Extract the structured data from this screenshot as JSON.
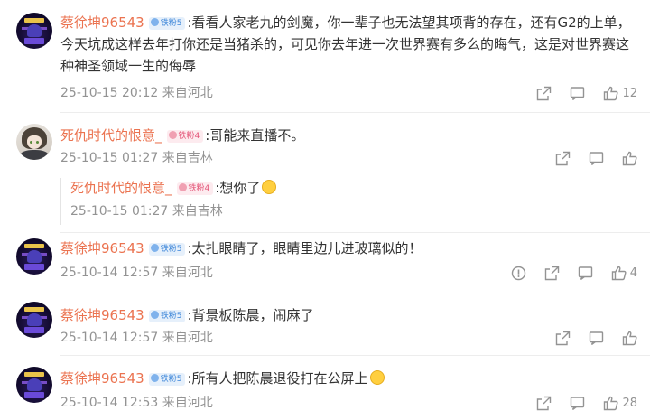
{
  "comments": [
    {
      "username": "蔡徐坤96543",
      "badge": "铁粉5",
      "text_lines": [
        "看看人家老九的剑魔，你一辈子也无法望其项背的存在，还有G2的上单，",
        "今天坑成这样去年打你还是当猪杀的，可见你去年进一次世界赛有多么的晦气，这是对世界赛这",
        "种神圣领域一生的侮辱"
      ],
      "timestamp": "25-10-15 20:12",
      "location": "来自河北",
      "likes": "12"
    },
    {
      "username": "死仇时代的恨意_",
      "badge": "铁粉4",
      "text": "哥能来直播不。",
      "timestamp": "25-10-15 01:27",
      "location": "来自吉林",
      "reply": {
        "username": "死仇时代的恨意_",
        "badge": "铁粉4",
        "text": "想你了",
        "emoji": "heart-eyes-emoji",
        "timestamp": "25-10-15 01:27",
        "location": "来自吉林"
      }
    },
    {
      "username": "蔡徐坤96543",
      "badge": "铁粉5",
      "text": "太扎眼睛了，眼睛里边儿进玻璃似的！",
      "timestamp": "25-10-14 12:57",
      "location": "来自河北",
      "likes": "4"
    },
    {
      "username": "蔡徐坤96543",
      "badge": "铁粉5",
      "text": "背景板陈晨，闹麻了",
      "timestamp": "25-10-14 12:57",
      "location": "来自河北"
    },
    {
      "username": "蔡徐坤96543",
      "badge": "铁粉5",
      "text": "所有人把陈晨退役打在公屏上",
      "emoji": "shocked-face-emoji",
      "timestamp": "25-10-14 12:53",
      "location": "来自河北",
      "likes": "28"
    }
  ],
  "separator": ":",
  "icons": {
    "share": "share-icon",
    "comment": "comment-icon",
    "like": "thumbs-up-icon",
    "report": "report-icon"
  },
  "colors": {
    "username": "#eb7350",
    "meta": "#939393",
    "badge_blue": "#3a84d8",
    "badge_pink": "#e45578"
  }
}
